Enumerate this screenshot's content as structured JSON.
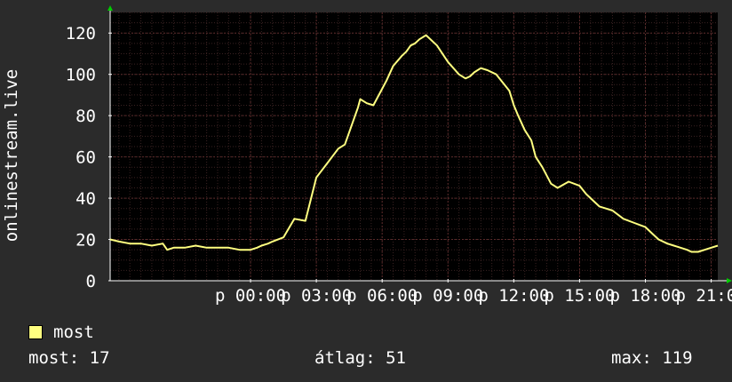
{
  "chart_data": {
    "type": "line",
    "ylabel": "onlinestream.live",
    "xlabel": "",
    "ylim": [
      0,
      130
    ],
    "yticks": [
      0,
      20,
      40,
      60,
      80,
      100,
      120
    ],
    "x_range_hours": [
      -6.4,
      21.3
    ],
    "x_ticks": [
      {
        "hour": 0,
        "label": "p 00:00"
      },
      {
        "hour": 3,
        "label": "p 03:00"
      },
      {
        "hour": 6,
        "label": "p 06:00"
      },
      {
        "hour": 9,
        "label": "p 09:00"
      },
      {
        "hour": 12,
        "label": "p 12:00"
      },
      {
        "hour": 15,
        "label": "p 15:00"
      },
      {
        "hour": 18,
        "label": "p 18:00"
      },
      {
        "hour": 21,
        "label": "p 21:00"
      }
    ],
    "grid": true,
    "series": [
      {
        "name": "most",
        "color": "#ffff80",
        "x": [
          -6.4,
          -6.0,
          -5.5,
          -5.0,
          -4.5,
          -4.0,
          -3.8,
          -3.5,
          -3.0,
          -2.5,
          -2.0,
          -1.5,
          -1.0,
          -0.5,
          0.0,
          0.3,
          0.5,
          0.8,
          1.0,
          1.5,
          2.0,
          2.5,
          3.0,
          3.5,
          4.0,
          4.3,
          4.6,
          4.9,
          5.0,
          5.3,
          5.6,
          5.9,
          6.2,
          6.5,
          6.9,
          7.1,
          7.3,
          7.5,
          7.7,
          8.0,
          8.5,
          9.0,
          9.5,
          9.8,
          10.0,
          10.2,
          10.5,
          10.8,
          11.2,
          11.5,
          11.8,
          12.0,
          12.2,
          12.5,
          12.8,
          13.0,
          13.3,
          13.7,
          14.0,
          14.5,
          15.0,
          15.3,
          15.6,
          15.9,
          16.2,
          16.5,
          17.0,
          17.5,
          18.0,
          18.3,
          18.6,
          19.0,
          19.3,
          19.6,
          19.9,
          20.1,
          20.4,
          20.7,
          21.0,
          21.3
        ],
        "values": [
          20,
          19,
          18,
          18,
          17,
          18,
          15,
          16,
          16,
          17,
          16,
          16,
          16,
          15,
          15,
          16,
          17,
          18,
          19,
          21,
          30,
          29,
          50,
          57,
          64,
          66,
          75,
          84,
          88,
          86,
          85,
          91,
          97,
          104,
          109,
          111,
          114,
          115,
          117,
          119,
          114,
          106,
          100,
          98,
          99,
          101,
          103,
          102,
          100,
          96,
          92,
          85,
          80,
          73,
          68,
          60,
          55,
          47,
          45,
          48,
          46,
          42,
          39,
          36,
          35,
          34,
          30,
          28,
          26,
          23,
          20,
          18,
          17,
          16,
          15,
          14,
          14,
          15,
          16,
          17
        ]
      }
    ]
  },
  "legend": {
    "label": "most",
    "color": "#ffff80"
  },
  "stats": {
    "last": "most: 17",
    "average": "átlag: 51",
    "max": "max: 119"
  },
  "colors": {
    "background": "#2b2b2b",
    "plot_background": "#000000",
    "grid": "#5a2a2a",
    "axis": "#ffffff",
    "axis_arrow": "#00cc00",
    "text": "#ffffff"
  }
}
